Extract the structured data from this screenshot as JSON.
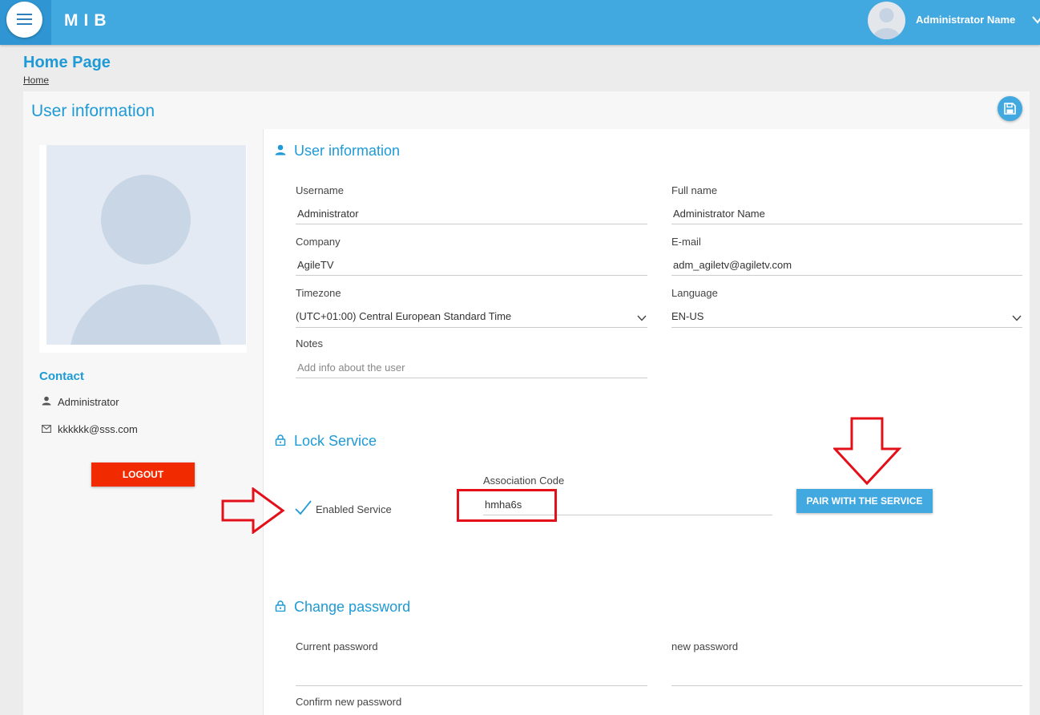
{
  "header": {
    "brand": "MIB",
    "user_name": "Administrator Name",
    "icons": [
      "menu-icon",
      "avatar-icon",
      "chevron-down-icon"
    ]
  },
  "page": {
    "title": "Home Page",
    "breadcrumb": "Home"
  },
  "card": {
    "title": "User information",
    "save_icon": "save-icon"
  },
  "contact": {
    "title": "Contact",
    "name": "Administrator",
    "email": "kkkkkk@sss.com",
    "logout_label": "LOGOUT"
  },
  "user_info": {
    "title": "User information",
    "username": {
      "label": "Username",
      "value": "Administrator"
    },
    "fullname": {
      "label": "Full name",
      "value": "Administrator Name"
    },
    "company": {
      "label": "Company",
      "value": "AgileTV"
    },
    "email": {
      "label": "E-mail",
      "value": "adm_agiletv@agiletv.com"
    },
    "timezone": {
      "label": "Timezone",
      "value": "(UTC+01:00) Central European Standard Time"
    },
    "language": {
      "label": "Language",
      "value": "EN-US"
    },
    "notes": {
      "label": "Notes",
      "placeholder": "Add info about the user"
    }
  },
  "lock_service": {
    "title": "Lock Service",
    "enabled_label": "Enabled Service",
    "enabled": true,
    "association_code_label": "Association Code",
    "association_code": "hmha6s",
    "pair_button": "PAIR WITH THE SERVICE"
  },
  "change_password": {
    "title": "Change password",
    "current_label": "Current password",
    "new_label": "new password",
    "confirm_label": "Confirm new password"
  },
  "colors": {
    "accent": "#42a8e0",
    "title": "#1e9ad6",
    "logout": "#f22a00",
    "annotation": "#e3101a"
  }
}
